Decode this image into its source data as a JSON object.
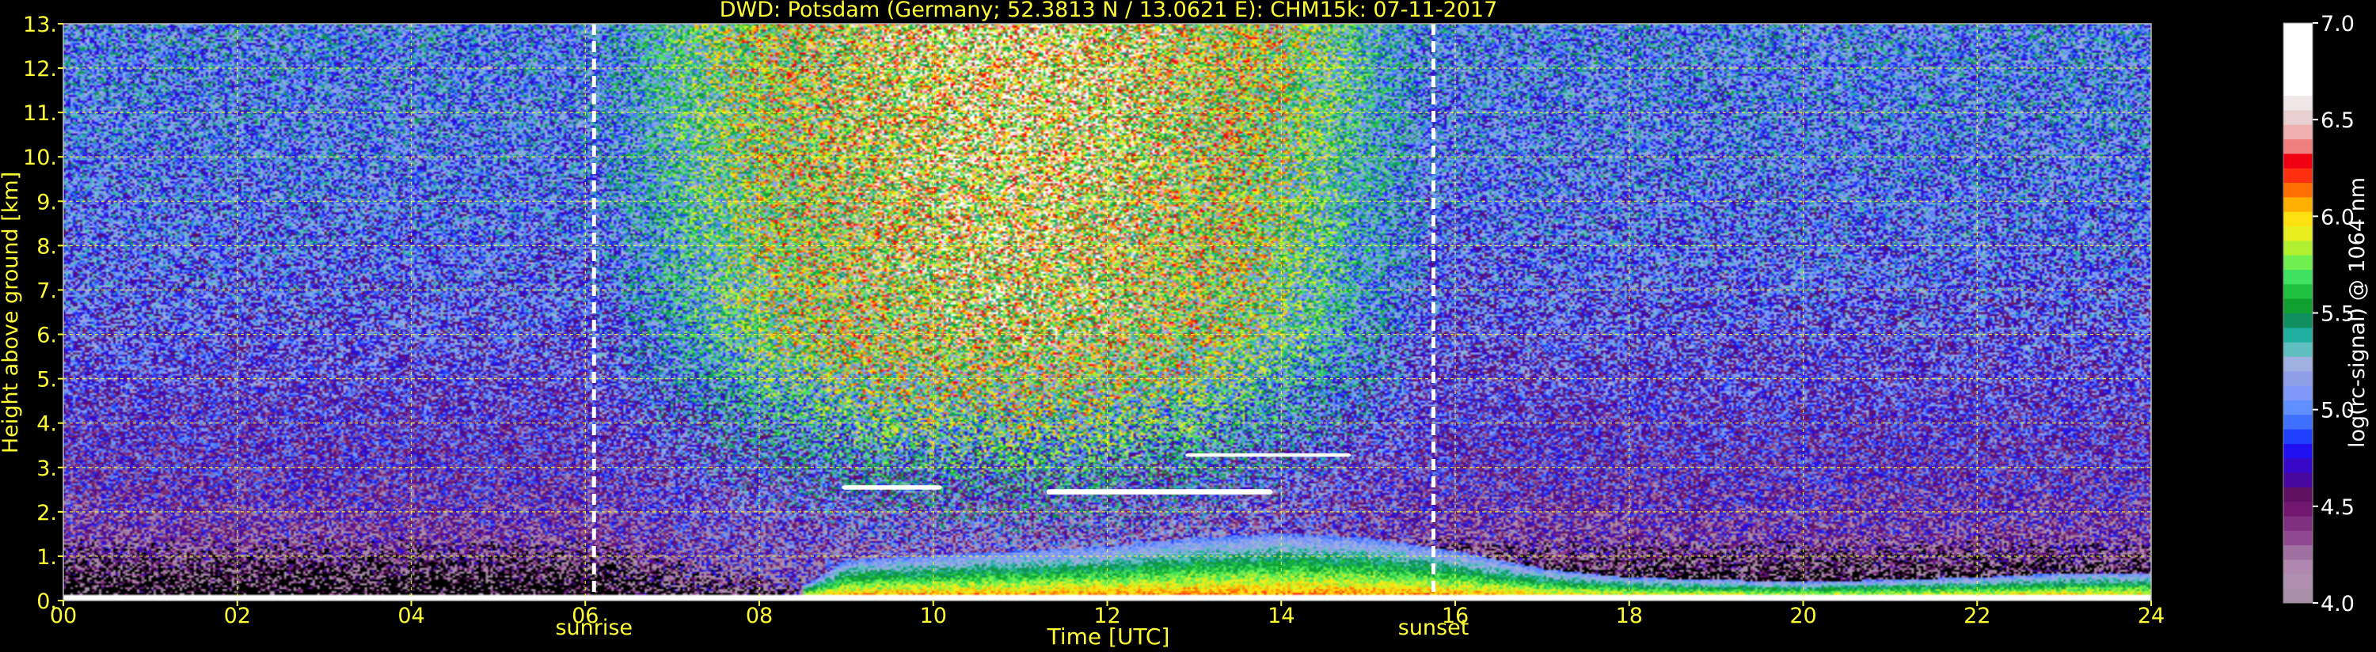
{
  "chart_data": {
    "type": "heatmap",
    "title": "DWD: Potsdam (Germany; 52.3813 N / 13.0621 E):    CHM15k: 07-11-2017",
    "xlabel": "Time [UTC]",
    "ylabel": "Height above ground [km]",
    "colorbar_label": "log(rc-signal) @ 1064 nm",
    "xlim": [
      0,
      24
    ],
    "ylim": [
      0,
      13
    ],
    "x_ticks": [
      {
        "value": 0,
        "label": "00"
      },
      {
        "value": 2,
        "label": "02"
      },
      {
        "value": 4,
        "label": "04"
      },
      {
        "value": 6,
        "label": "06"
      },
      {
        "value": 8,
        "label": "08"
      },
      {
        "value": 10,
        "label": "10"
      },
      {
        "value": 12,
        "label": "12"
      },
      {
        "value": 14,
        "label": "14"
      },
      {
        "value": 16,
        "label": "16"
      },
      {
        "value": 18,
        "label": "18"
      },
      {
        "value": 20,
        "label": "20"
      },
      {
        "value": 22,
        "label": "22"
      },
      {
        "value": 24,
        "label": "24"
      }
    ],
    "y_ticks": [
      {
        "value": 0,
        "label": "0."
      },
      {
        "value": 1,
        "label": "1."
      },
      {
        "value": 2,
        "label": "2."
      },
      {
        "value": 3,
        "label": "3."
      },
      {
        "value": 4,
        "label": "4."
      },
      {
        "value": 5,
        "label": "5."
      },
      {
        "value": 6,
        "label": "6."
      },
      {
        "value": 7,
        "label": "7."
      },
      {
        "value": 8,
        "label": "8."
      },
      {
        "value": 9,
        "label": "9."
      },
      {
        "value": 10,
        "label": "10."
      },
      {
        "value": 11,
        "label": "11."
      },
      {
        "value": 12,
        "label": "12."
      },
      {
        "value": 13,
        "label": "13."
      }
    ],
    "colorbar_range": [
      4.0,
      7.0
    ],
    "colorbar_ticks": [
      {
        "value": 4.0,
        "label": "4.0"
      },
      {
        "value": 4.5,
        "label": "4.5"
      },
      {
        "value": 5.0,
        "label": "5.0"
      },
      {
        "value": 5.5,
        "label": "5.5"
      },
      {
        "value": 6.0,
        "label": "6.0"
      },
      {
        "value": 6.5,
        "label": "6.5"
      },
      {
        "value": 7.0,
        "label": "7.0"
      }
    ],
    "colorbar_colors": [
      "#a890a8",
      "#b090b0",
      "#b088b0",
      "#a070a0",
      "#904890",
      "#803080",
      "#701870",
      "#601060",
      "#4808a0",
      "#3808c8",
      "#2010f0",
      "#2040ff",
      "#4070ff",
      "#6090ff",
      "#8098f8",
      "#90a0e8",
      "#a0b0e0",
      "#60c0c0",
      "#20b0a0",
      "#109060",
      "#10a030",
      "#20c040",
      "#40e060",
      "#70f050",
      "#b0f030",
      "#e8f020",
      "#ffe010",
      "#ffb000",
      "#ff7000",
      "#ff3010",
      "#f00010",
      "#f08080",
      "#f0b0b0",
      "#e8d0d0",
      "#f0e8e8",
      "#ffffff",
      "#ffffff",
      "#ffffff",
      "#ffffff",
      "#ffffff"
    ],
    "grid": true,
    "sun_events": [
      {
        "time": 6.1,
        "label": "sunrise"
      },
      {
        "time": 15.75,
        "label": "sunset"
      }
    ],
    "cloud_layers": [
      {
        "t_start": 8.95,
        "t_end": 10.1,
        "height_km": 2.55,
        "thickness_km": 0.1
      },
      {
        "t_start": 11.3,
        "t_end": 13.9,
        "height_km": 2.45,
        "thickness_km": 0.12
      },
      {
        "t_start": 12.9,
        "t_end": 14.8,
        "height_km": 3.28,
        "thickness_km": 0.08
      }
    ],
    "boundary_layer_top": [
      [
        0,
        0.15
      ],
      [
        2,
        0.15
      ],
      [
        4,
        0.15
      ],
      [
        6,
        0.15
      ],
      [
        8,
        0.2
      ],
      [
        8.6,
        0.4
      ],
      [
        9,
        0.9
      ],
      [
        10,
        1.0
      ],
      [
        11,
        1.1
      ],
      [
        12,
        1.2
      ],
      [
        13,
        1.4
      ],
      [
        14,
        1.5
      ],
      [
        15,
        1.4
      ],
      [
        16,
        1.1
      ],
      [
        17,
        0.7
      ],
      [
        18,
        0.5
      ],
      [
        20,
        0.4
      ],
      [
        22,
        0.5
      ],
      [
        23,
        0.6
      ],
      [
        24,
        0.6
      ]
    ],
    "colormap": "nipy_spectral"
  }
}
